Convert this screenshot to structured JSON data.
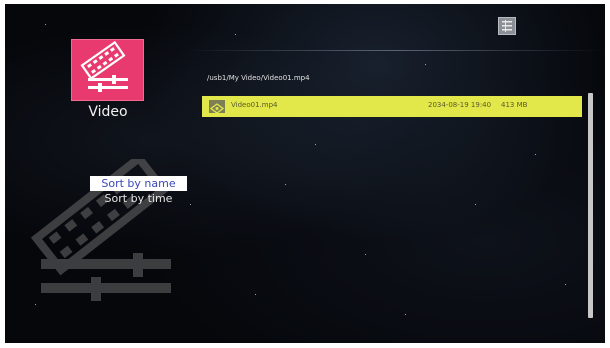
{
  "sidebar": {
    "app_label": "Video",
    "sort_options": [
      "Sort by name",
      "Sort by time"
    ],
    "selected_sort": "Sort by name"
  },
  "browser": {
    "path": "/usb1/My Video/Video01.mp4",
    "files": [
      {
        "name": "Video01.mp4",
        "date": "2034-08-19 19:40",
        "size": "413 MB",
        "selected": true
      }
    ]
  },
  "icons": {
    "app_icon": "film-editing-icon",
    "top_icon": "list-view-icon",
    "file_icon": "video-file-icon"
  },
  "colors": {
    "app_tile": "#e83a6e",
    "selected_row": "#e3e84a",
    "selected_sort_text": "#3b48b8",
    "background": "#05070b"
  }
}
